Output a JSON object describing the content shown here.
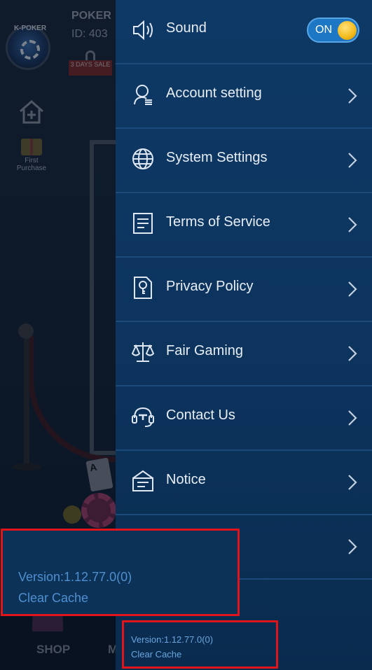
{
  "background": {
    "brand": "K-POKER",
    "player_name": "POKER",
    "player_id": "ID: 403",
    "sale_badge": "3 DAYS SALE",
    "first_purchase": "First Purchase",
    "card_rank": "A",
    "bottom_nav": {
      "shop": "SHOP",
      "m": "M"
    }
  },
  "settings_menu": {
    "sound": {
      "label": "Sound",
      "toggle_text": "ON",
      "enabled": true
    },
    "items": [
      {
        "label": "Account setting",
        "icon": "account-icon"
      },
      {
        "label": "System Settings",
        "icon": "globe-icon"
      },
      {
        "label": "Terms of Service",
        "icon": "document-icon"
      },
      {
        "label": "Privacy Policy",
        "icon": "privacy-icon"
      },
      {
        "label": "Fair Gaming",
        "icon": "scales-icon"
      },
      {
        "label": "Contact Us",
        "icon": "headset-icon"
      },
      {
        "label": "Notice",
        "icon": "notice-icon"
      }
    ],
    "version": "Version:1.12.77.0(0)",
    "clear_cache": "Clear Cache"
  },
  "callout": {
    "version": "Version:1.12.77.0(0)",
    "clear_cache": "Clear Cache"
  },
  "colors": {
    "drawer": "#0e3a68",
    "accent_text": "#69a6e0",
    "toggle": "#1d77c5",
    "highlight": "#e0141a"
  }
}
